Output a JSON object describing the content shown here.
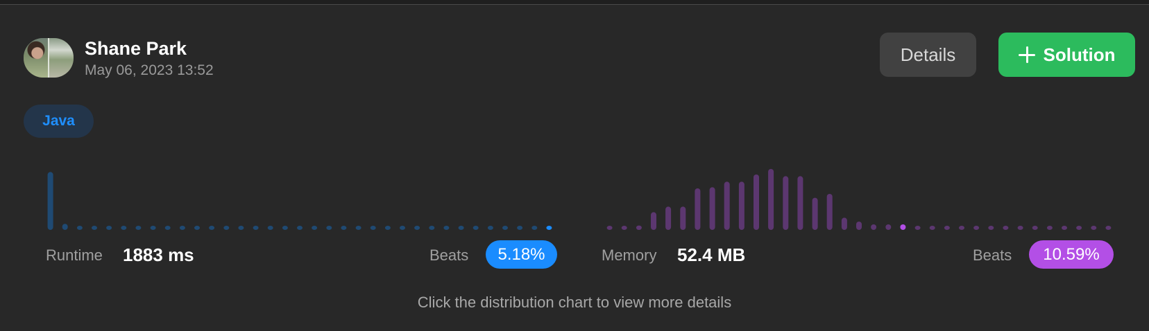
{
  "header": {
    "user_name": "Shane Park",
    "timestamp": "May 06, 2023 13:52",
    "details_label": "Details",
    "solution_label": "Solution",
    "solution_icon": "plus-icon"
  },
  "language_tag": "Java",
  "runtime": {
    "label": "Runtime",
    "value": "1883 ms",
    "beats_label": "Beats",
    "beats_value": "5.18%",
    "accent_color": "#1a8cff",
    "bar_color": "#1f4a73"
  },
  "memory": {
    "label": "Memory",
    "value": "52.4 MB",
    "beats_label": "Beats",
    "beats_value": "10.59%",
    "accent_color": "#b34fe6",
    "bar_color": "#5c3770"
  },
  "footer_note": "Click the distribution chart to view more details",
  "chart_data": [
    {
      "type": "bar",
      "name": "runtime-distribution",
      "values": [
        0.95,
        0.1,
        0.04,
        0.04,
        0.04,
        0.04,
        0.04,
        0.04,
        0.04,
        0.04,
        0.04,
        0.04,
        0.04,
        0.04,
        0.04,
        0.04,
        0.04,
        0.04,
        0.04,
        0.04,
        0.04,
        0.04,
        0.04,
        0.04,
        0.04,
        0.04,
        0.04,
        0.04,
        0.04,
        0.04,
        0.04,
        0.04,
        0.04,
        0.04,
        0.04
      ],
      "highlight_index": 34,
      "ylim": [
        0,
        1
      ]
    },
    {
      "type": "bar",
      "name": "memory-distribution",
      "values": [
        0.04,
        0.04,
        0.08,
        0.32,
        0.42,
        0.42,
        0.75,
        0.77,
        0.87,
        0.87,
        1.0,
        1.1,
        0.97,
        0.97,
        0.58,
        0.65,
        0.22,
        0.15,
        0.1,
        0.1,
        0.1,
        0.05,
        0.05,
        0.05,
        0.05,
        0.05,
        0.05,
        0.05,
        0.05,
        0.05,
        0.05,
        0.05,
        0.05,
        0.05,
        0.05
      ],
      "highlight_index": 20,
      "ylim": [
        0,
        1.1
      ]
    }
  ]
}
